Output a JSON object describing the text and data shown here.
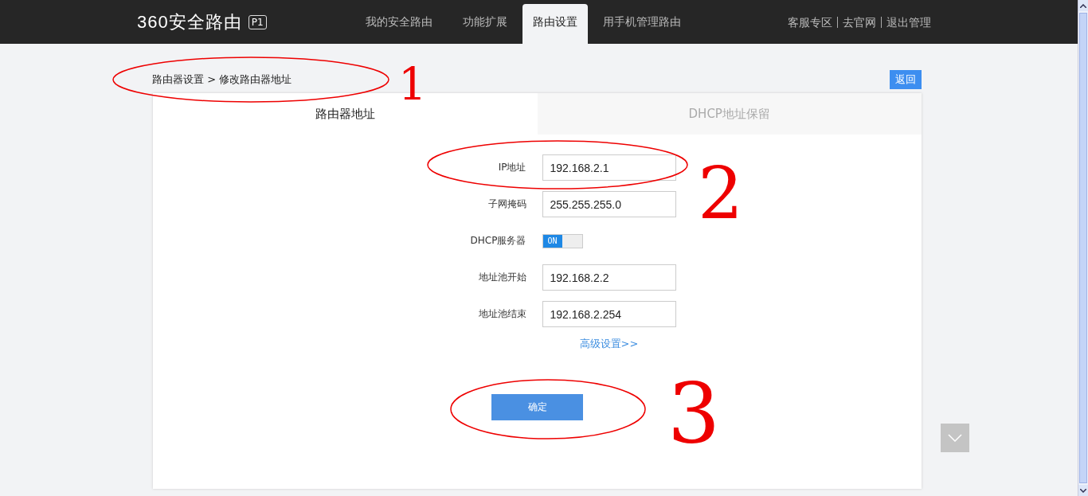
{
  "header": {
    "logo": "360安全路由",
    "model_badge": "P1",
    "nav": [
      {
        "label": "我的安全路由",
        "selected": false
      },
      {
        "label": "功能扩展",
        "selected": false
      },
      {
        "label": "路由设置",
        "selected": true
      },
      {
        "label": "用手机管理路由",
        "selected": false
      }
    ],
    "links": [
      "客服专区",
      "去官网",
      "退出管理"
    ]
  },
  "breadcrumb": "路由器设置 > 修改路由器地址",
  "back_button": "返回",
  "tabs": [
    {
      "label": "路由器地址",
      "selected": true
    },
    {
      "label": "DHCP地址保留",
      "selected": false
    }
  ],
  "form": [
    {
      "kind": "input",
      "label": "IP地址",
      "value": "192.168.2.1"
    },
    {
      "kind": "input",
      "label": "子网掩码",
      "value": "255.255.255.0"
    },
    {
      "kind": "toggle",
      "label": "DHCP服务器",
      "on": true,
      "text": "ON"
    },
    {
      "kind": "input",
      "label": "地址池开始",
      "value": "192.168.2.2"
    },
    {
      "kind": "input",
      "label": "地址池结束",
      "value": "192.168.2.254"
    }
  ],
  "advanced_link": "高级设置>>",
  "confirm_button": "确定",
  "annotations": {
    "ellipses": [
      {
        "kind": "ellipse"
      },
      {
        "kind": "ellipse"
      },
      {
        "kind": "ellipse"
      }
    ],
    "numbers": [
      "1",
      "2",
      "3"
    ]
  }
}
